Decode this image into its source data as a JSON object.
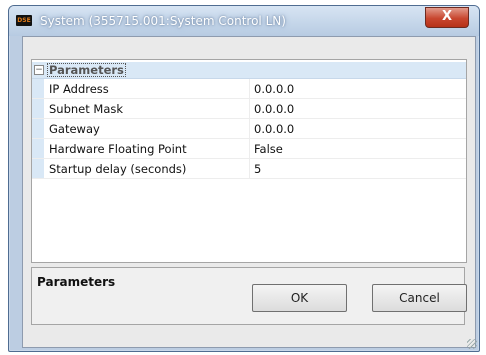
{
  "window": {
    "title": "System (355715.001:System Control LN)",
    "icon": "dse-app-icon",
    "icon_text": "DSE",
    "close_glyph": "X"
  },
  "grid": {
    "category": {
      "expander": "−",
      "label": "Parameters"
    },
    "properties": [
      {
        "name": "IP Address",
        "value": "0.0.0.0"
      },
      {
        "name": "Subnet Mask",
        "value": "0.0.0.0"
      },
      {
        "name": "Gateway",
        "value": "0.0.0.0"
      },
      {
        "name": "Hardware Floating Point",
        "value": "False"
      },
      {
        "name": "Startup delay (seconds)",
        "value": "5"
      }
    ]
  },
  "help": {
    "title": "Parameters"
  },
  "buttons": {
    "ok": "OK",
    "cancel": "Cancel"
  }
}
